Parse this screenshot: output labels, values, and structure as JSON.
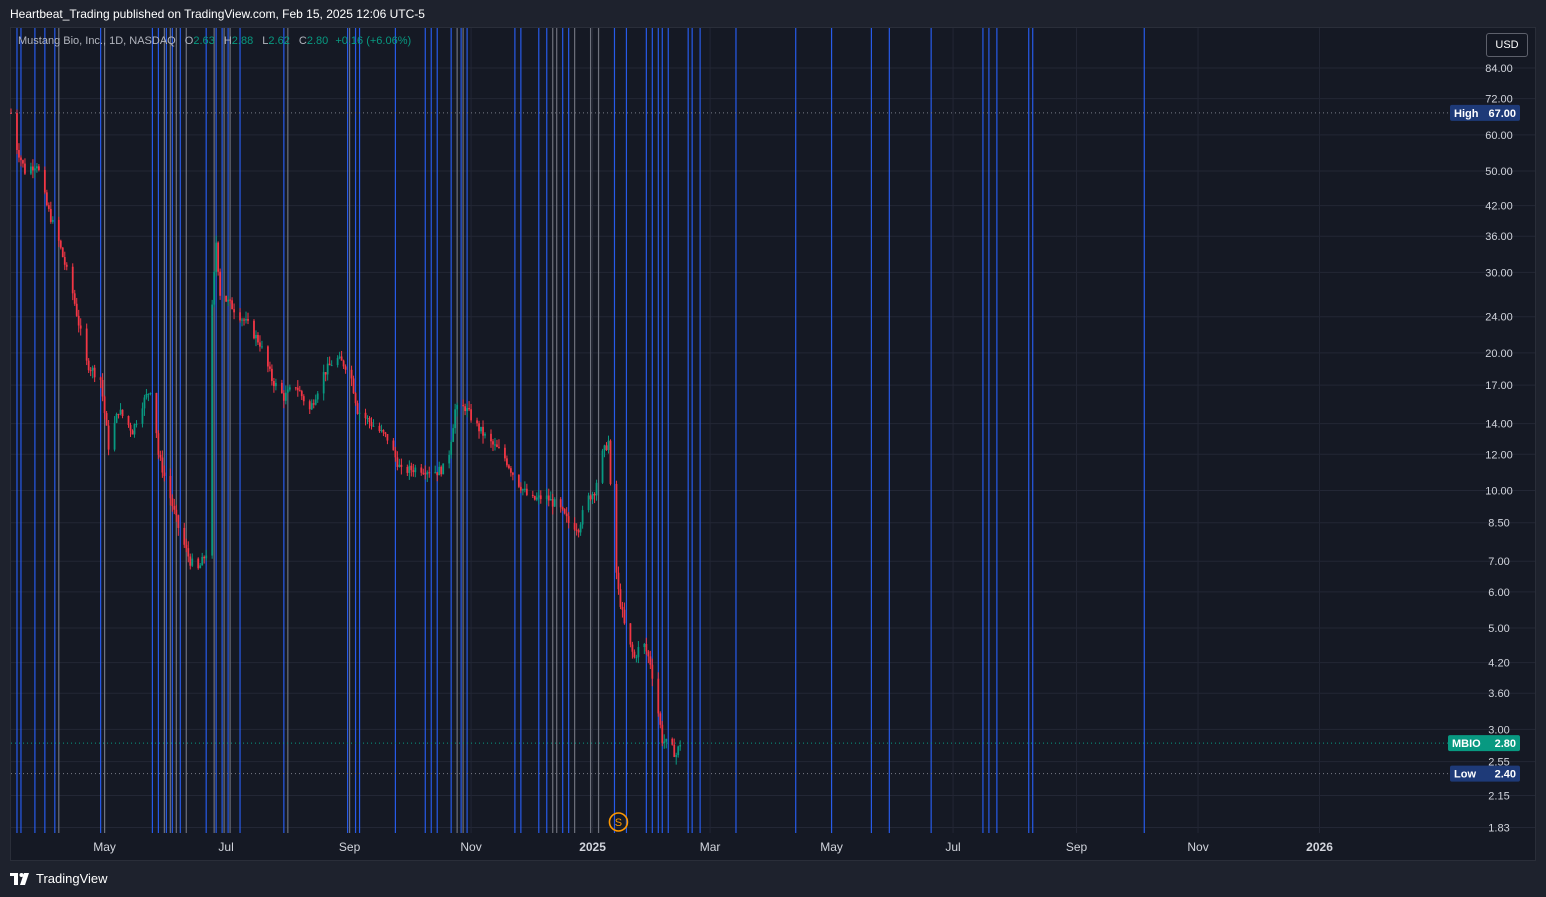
{
  "header": {
    "published_text": "Heartbeat_Trading published on TradingView.com, Feb 15, 2025 12:06 UTC-5"
  },
  "legend": {
    "symbol_text": "Mustang Bio, Inc., 1D, NASDAQ",
    "open_label": "O",
    "open_value": "2.63",
    "high_label": "H",
    "high_value": "2.88",
    "low_label": "L",
    "low_value": "2.62",
    "close_label": "C",
    "close_value": "2.80",
    "change_text": "+0.16 (+6.06%)"
  },
  "currency_button": "USD",
  "footer": {
    "brand": "TradingView"
  },
  "colors": {
    "up": "#089981",
    "down": "#f23645",
    "blue_line": "#2962ff",
    "grey_line": "#787b86",
    "panel_bg": "#151924",
    "axis_text": "#d1d4dc",
    "high_low_tag": "#1e3a78",
    "symbol_tag": "#089981"
  },
  "icons": {
    "footer_logo": "tradingview-logo-icon",
    "event_marker": "split-event-icon"
  },
  "chart_data": {
    "type": "candlestick",
    "symbol": "MBIO",
    "y_scale": "log",
    "y_ticks": [
      "84.00",
      "72.00",
      "60.00",
      "50.00",
      "42.00",
      "36.00",
      "30.00",
      "24.00",
      "20.00",
      "17.00",
      "14.00",
      "12.00",
      "10.00",
      "8.50",
      "7.00",
      "6.00",
      "5.00",
      "4.20",
      "3.60",
      "3.00",
      "2.55",
      "2.15",
      "1.83"
    ],
    "x_ticks": [
      {
        "date": "2024-05-01",
        "label": "May",
        "bold": false
      },
      {
        "date": "2024-07-01",
        "label": "Jul",
        "bold": false
      },
      {
        "date": "2024-09-01",
        "label": "Sep",
        "bold": false
      },
      {
        "date": "2024-11-01",
        "label": "Nov",
        "bold": false
      },
      {
        "date": "2025-01-01",
        "label": "2025",
        "bold": true
      },
      {
        "date": "2025-03-01",
        "label": "Mar",
        "bold": false
      },
      {
        "date": "2025-05-01",
        "label": "May",
        "bold": false
      },
      {
        "date": "2025-07-01",
        "label": "Jul",
        "bold": false
      },
      {
        "date": "2025-09-01",
        "label": "Sep",
        "bold": false
      },
      {
        "date": "2025-11-01",
        "label": "Nov",
        "bold": false
      },
      {
        "date": "2026-01-01",
        "label": "2026",
        "bold": true
      }
    ],
    "x_range": [
      "2024-03-15",
      "2026-03-05"
    ],
    "y_range": [
      1.78,
      92
    ],
    "price_tags": [
      {
        "label": "High",
        "value": "67.00",
        "price": 67.0,
        "line": true
      },
      {
        "label": "MBIO",
        "value": "2.80",
        "price": 2.8,
        "line": true
      },
      {
        "label": "Low",
        "value": "2.40",
        "price": 2.4,
        "line": true
      }
    ],
    "event_marker": {
      "label": "S",
      "date": "2025-01-14"
    },
    "price_path": [
      [
        "2024-03-15",
        67
      ],
      [
        "2024-03-17",
        58
      ],
      [
        "2024-03-22",
        50
      ],
      [
        "2024-03-28",
        52
      ],
      [
        "2024-04-02",
        42
      ],
      [
        "2024-04-08",
        35
      ],
      [
        "2024-04-15",
        27
      ],
      [
        "2024-04-22",
        19
      ],
      [
        "2024-04-29",
        17.5
      ],
      [
        "2024-05-03",
        12.5
      ],
      [
        "2024-05-08",
        15
      ],
      [
        "2024-05-15",
        13.5
      ],
      [
        "2024-05-20",
        15.5
      ],
      [
        "2024-05-25",
        17
      ],
      [
        "2024-05-28",
        12
      ],
      [
        "2024-06-02",
        10
      ],
      [
        "2024-06-08",
        8
      ],
      [
        "2024-06-13",
        7
      ],
      [
        "2024-06-17",
        6.7
      ],
      [
        "2024-06-21",
        7.3
      ],
      [
        "2024-06-24",
        25
      ],
      [
        "2024-06-26",
        35
      ],
      [
        "2024-06-28",
        27
      ],
      [
        "2024-07-05",
        25
      ],
      [
        "2024-07-12",
        23
      ],
      [
        "2024-07-18",
        21
      ],
      [
        "2024-07-24",
        17.5
      ],
      [
        "2024-07-30",
        16
      ],
      [
        "2024-08-05",
        17
      ],
      [
        "2024-08-12",
        15
      ],
      [
        "2024-08-19",
        18
      ],
      [
        "2024-08-25",
        19.5
      ],
      [
        "2024-09-01",
        18.5
      ],
      [
        "2024-09-05",
        15
      ],
      [
        "2024-09-12",
        14
      ],
      [
        "2024-09-20",
        13
      ],
      [
        "2024-09-27",
        11
      ],
      [
        "2024-10-05",
        11.2
      ],
      [
        "2024-10-15",
        11
      ],
      [
        "2024-10-20",
        11.3
      ],
      [
        "2024-10-24",
        15
      ],
      [
        "2024-10-29",
        15.2
      ],
      [
        "2024-11-03",
        14
      ],
      [
        "2024-11-10",
        12.8
      ],
      [
        "2024-11-17",
        12
      ],
      [
        "2024-11-24",
        10.5
      ],
      [
        "2024-12-01",
        9.5
      ],
      [
        "2024-12-08",
        9.7
      ],
      [
        "2024-12-15",
        9.2
      ],
      [
        "2024-12-20",
        8.5
      ],
      [
        "2024-12-25",
        8.3
      ],
      [
        "2024-12-29",
        9.5
      ],
      [
        "2025-01-02",
        10
      ],
      [
        "2025-01-06",
        12
      ],
      [
        "2025-01-09",
        12.8
      ],
      [
        "2025-01-11",
        8
      ],
      [
        "2025-01-14",
        6
      ],
      [
        "2025-01-18",
        4.8
      ],
      [
        "2025-01-22",
        4.3
      ],
      [
        "2025-01-26",
        4.7
      ],
      [
        "2025-01-30",
        4.2
      ],
      [
        "2025-02-02",
        3.5
      ],
      [
        "2025-02-05",
        2.85
      ],
      [
        "2025-02-09",
        2.75
      ],
      [
        "2025-02-12",
        2.64
      ],
      [
        "2025-02-14",
        2.8
      ]
    ],
    "blue_vlines": [
      "2024-03-18",
      "2024-03-20",
      "2024-03-27",
      "2024-04-01",
      "2024-04-06",
      "2024-04-29",
      "2024-05-25",
      "2024-05-28",
      "2024-06-01",
      "2024-06-04",
      "2024-06-08",
      "2024-06-21",
      "2024-06-26",
      "2024-06-29",
      "2024-07-02",
      "2024-07-08",
      "2024-07-30",
      "2024-08-31",
      "2024-09-04",
      "2024-09-06",
      "2024-09-24",
      "2024-10-09",
      "2024-10-12",
      "2024-10-15",
      "2024-10-22",
      "2024-10-27",
      "2024-10-30",
      "2024-11-23",
      "2024-11-26",
      "2024-12-05",
      "2024-12-09",
      "2024-12-17",
      "2024-12-20",
      "2025-01-12",
      "2025-01-18",
      "2025-01-28",
      "2025-01-31",
      "2025-02-03",
      "2025-02-05",
      "2025-02-08",
      "2025-02-18",
      "2025-02-20",
      "2025-02-24",
      "2025-03-14",
      "2025-04-13",
      "2025-05-01",
      "2025-05-21",
      "2025-05-30",
      "2025-06-20",
      "2025-07-16",
      "2025-07-19",
      "2025-07-23",
      "2025-08-08",
      "2025-08-10",
      "2025-10-05"
    ],
    "grey_vlines": [
      "2024-04-08",
      "2024-05-01",
      "2024-05-31",
      "2024-06-03",
      "2024-06-06",
      "2024-06-11",
      "2024-06-25",
      "2024-06-30",
      "2024-07-03",
      "2024-08-01",
      "2024-09-01",
      "2024-10-25",
      "2024-10-28",
      "2024-12-12",
      "2024-12-14",
      "2024-12-23",
      "2024-12-31",
      "2025-01-04"
    ]
  }
}
